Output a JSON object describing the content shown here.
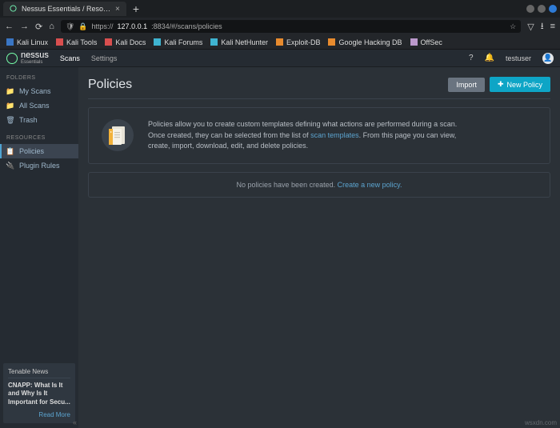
{
  "browser": {
    "tab_title": "Nessus Essentials / Reso…",
    "url_scheme": "https://",
    "url_host": "127.0.0.1",
    "url_rest": ":8834/#/scans/policies",
    "bookmarks": [
      {
        "label": "Kali Linux",
        "color": "#3a76c4"
      },
      {
        "label": "Kali Tools",
        "color": "#d94f4f"
      },
      {
        "label": "Kali Docs",
        "color": "#d94f4f"
      },
      {
        "label": "Kali Forums",
        "color": "#3fb4d1"
      },
      {
        "label": "Kali NetHunter",
        "color": "#3fb4d1"
      },
      {
        "label": "Exploit-DB",
        "color": "#e88b2e"
      },
      {
        "label": "Google Hacking DB",
        "color": "#e88b2e"
      },
      {
        "label": "OffSec",
        "color": "#b9c"
      }
    ]
  },
  "header": {
    "brand": "nessus",
    "brand_sub": "Essentials",
    "nav_scans": "Scans",
    "nav_settings": "Settings",
    "username": "testuser"
  },
  "sidebar": {
    "folders_hdr": "FOLDERS",
    "my_scans": "My Scans",
    "all_scans": "All Scans",
    "trash": "Trash",
    "resources_hdr": "RESOURCES",
    "policies": "Policies",
    "plugin_rules": "Plugin Rules",
    "news_hdr": "Tenable News",
    "news_body": "CNAPP: What Is It and Why Is It Important for Secu...",
    "news_link": "Read More"
  },
  "page": {
    "title": "Policies",
    "btn_import": "Import",
    "btn_new": "New Policy",
    "info_a": "Policies allow you to create custom templates defining what actions are performed during a scan. Once created, they can be selected from the list of ",
    "info_link": "scan templates",
    "info_b": ". From this page you can view, create, import, download, edit, and delete policies.",
    "empty_a": "No policies have been created. ",
    "empty_link": "Create a new policy."
  },
  "watermark": "wsxdn.com"
}
